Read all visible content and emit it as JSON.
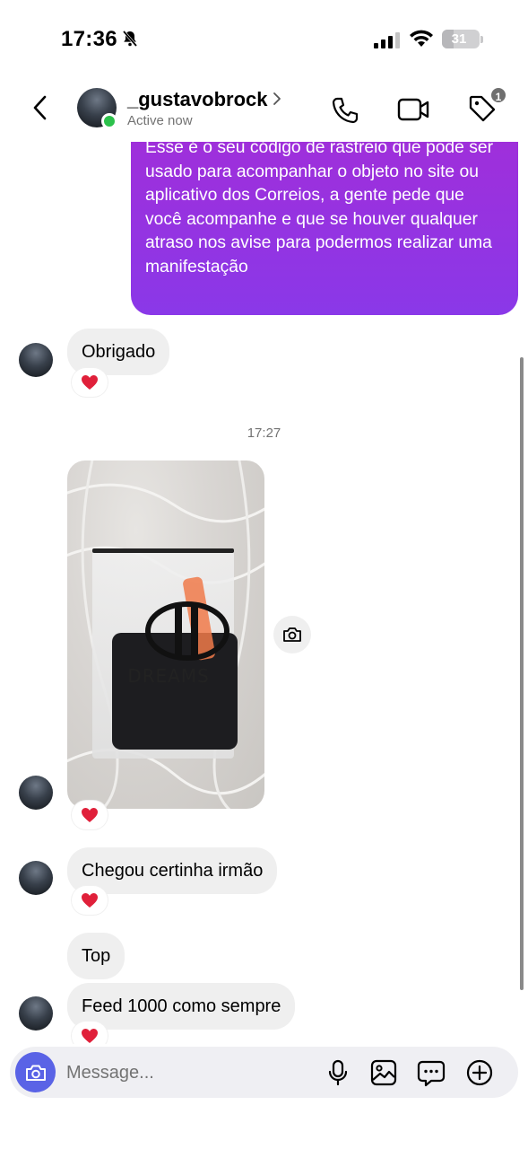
{
  "status_bar": {
    "time": "17:36",
    "battery": "31",
    "battery_level": 0.31
  },
  "header": {
    "username": "_gustavobrock",
    "status": "Active now",
    "tag_badge": "1"
  },
  "messages": {
    "outgoing_text": "Esse é o seu código de rastreio que pode ser usado para acompanhar o objeto no site ou aplicativo dos Correios, a gente pede que você acompanhe e que se houver qualquer atraso nos avise para podermos realizar uma manifestação",
    "incoming": [
      {
        "text": "Obrigado"
      },
      {
        "text": "Chegou certinha irmão"
      },
      {
        "text": "Top"
      },
      {
        "text": "Feed 1000 como sempre"
      }
    ],
    "timestamp": "17:27",
    "photo_brand": "DREAMS"
  },
  "composer": {
    "placeholder": "Message..."
  },
  "colors": {
    "accent": "#5a63e6",
    "outgoing_bubble": "#9d33de",
    "online": "#2cc14b",
    "heart": "#e0203a"
  },
  "icons": [
    "bell-off-icon",
    "signal-icon",
    "wifi-icon",
    "back-icon",
    "chevron-right-icon",
    "phone-icon",
    "video-icon",
    "tag-icon",
    "heart-icon",
    "camera-icon",
    "microphone-icon",
    "gallery-icon",
    "sticker-icon",
    "plus-icon"
  ]
}
